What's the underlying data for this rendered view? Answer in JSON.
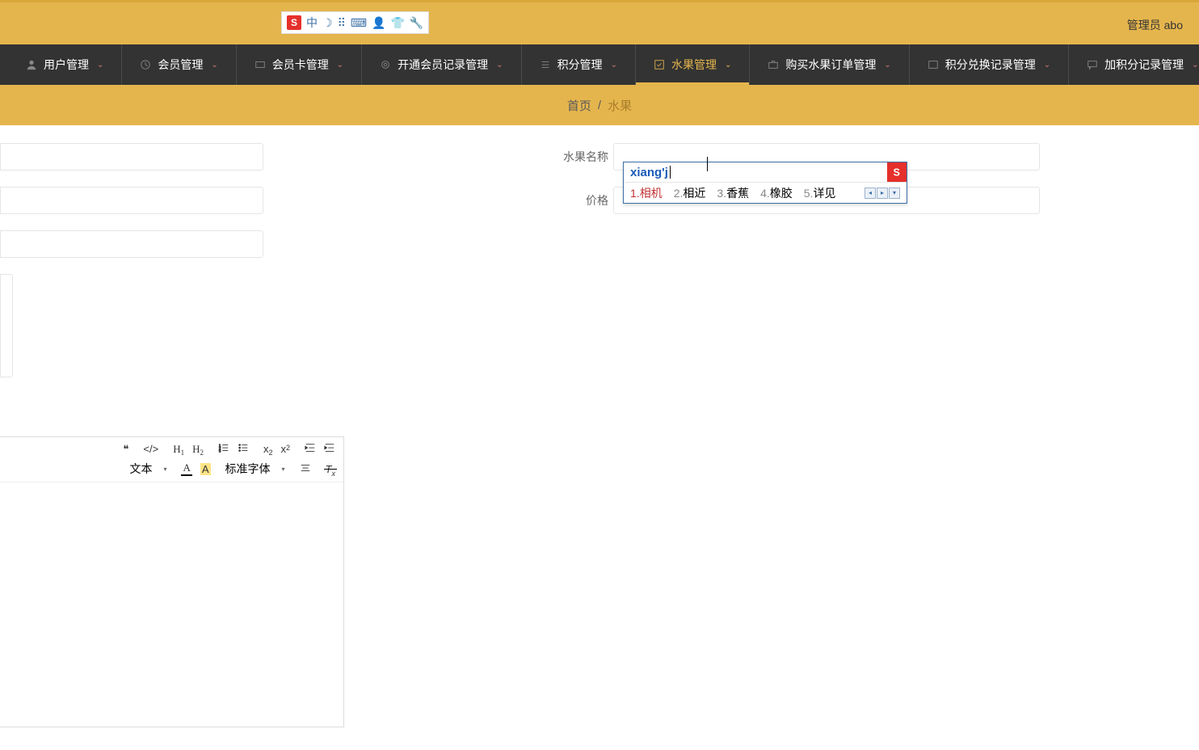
{
  "header": {
    "admin_label": "管理员 abo"
  },
  "ime_toolbar": {
    "mode_glyph": "中",
    "moon_glyph": "☽",
    "dots_glyph": "⠿",
    "keyboard_glyph": "⌨",
    "person_glyph": "👤",
    "shirt_glyph": "👕",
    "wrench_glyph": "🔧"
  },
  "nav": {
    "items": [
      {
        "label": "用户管理"
      },
      {
        "label": "会员管理"
      },
      {
        "label": "会员卡管理"
      },
      {
        "label": "开通会员记录管理"
      },
      {
        "label": "积分管理"
      },
      {
        "label": "水果管理"
      },
      {
        "label": "购买水果订单管理"
      },
      {
        "label": "积分兑换记录管理"
      },
      {
        "label": "加积分记录管理"
      }
    ]
  },
  "breadcrumb": {
    "home": "首页",
    "sep": "/",
    "current": "水果"
  },
  "form": {
    "name_label": "水果名称",
    "price_label": "价格",
    "name_value": "",
    "price_value": ""
  },
  "ime_popup": {
    "pinyin": "xiang'j",
    "sogou_badge": "S",
    "candidates": [
      {
        "num": "1.",
        "text": "相机"
      },
      {
        "num": "2.",
        "text": "相近"
      },
      {
        "num": "3.",
        "text": "香蕉"
      },
      {
        "num": "4.",
        "text": "橡胶"
      },
      {
        "num": "5.",
        "text": "详见"
      }
    ]
  },
  "editor": {
    "quote": "❝",
    "code": "</>",
    "h1": "H",
    "h1_sub": "1",
    "h2": "H",
    "h2_sub": "2",
    "ol": "≡",
    "ul": "≣",
    "sub_x": "x",
    "sub_2": "2",
    "sup_x": "x",
    "sup_2": "2",
    "outdent": "⇤",
    "indent": "⇥",
    "style_select": "文本",
    "caret": "▾",
    "font_A": "A",
    "hl_A": "A",
    "font_select": "标准字体",
    "align": "≡",
    "clear": "T"
  }
}
